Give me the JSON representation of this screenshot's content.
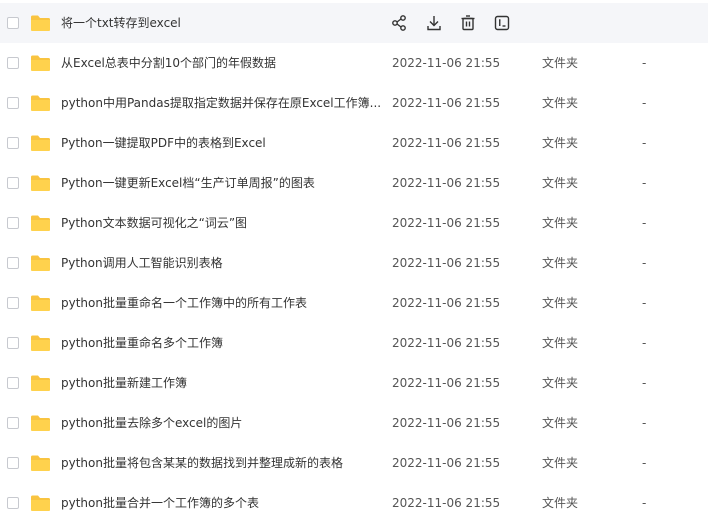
{
  "columns": {
    "type_label": "文件夹",
    "size_placeholder": "-"
  },
  "hover_actions": [
    {
      "name": "share-icon",
      "label": "share"
    },
    {
      "name": "download-icon",
      "label": "download"
    },
    {
      "name": "delete-icon",
      "label": "delete"
    },
    {
      "name": "more-info-icon",
      "label": "info"
    }
  ],
  "files": [
    {
      "name": "将一个txt转存到excel",
      "date": "",
      "type": "",
      "size": "",
      "hovered": true
    },
    {
      "name": "从Excel总表中分割10个部门的年假数据",
      "date": "2022-11-06 21:55",
      "type": "文件夹",
      "size": "-"
    },
    {
      "name": "python中用Pandas提取指定数据并保存在原Excel工作簿...",
      "date": "2022-11-06 21:55",
      "type": "文件夹",
      "size": "-"
    },
    {
      "name": "Python一键提取PDF中的表格到Excel",
      "date": "2022-11-06 21:55",
      "type": "文件夹",
      "size": "-"
    },
    {
      "name": "Python一键更新Excel档“生产订单周报”的图表",
      "date": "2022-11-06 21:55",
      "type": "文件夹",
      "size": "-"
    },
    {
      "name": "Python文本数据可视化之“词云”图",
      "date": "2022-11-06 21:55",
      "type": "文件夹",
      "size": "-"
    },
    {
      "name": "Python调用人工智能识别表格",
      "date": "2022-11-06 21:55",
      "type": "文件夹",
      "size": "-"
    },
    {
      "name": "python批量重命名一个工作簿中的所有工作表",
      "date": "2022-11-06 21:55",
      "type": "文件夹",
      "size": "-"
    },
    {
      "name": "python批量重命名多个工作簿",
      "date": "2022-11-06 21:55",
      "type": "文件夹",
      "size": "-"
    },
    {
      "name": "python批量新建工作簿",
      "date": "2022-11-06 21:55",
      "type": "文件夹",
      "size": "-"
    },
    {
      "name": "python批量去除多个excel的图片",
      "date": "2022-11-06 21:55",
      "type": "文件夹",
      "size": "-"
    },
    {
      "name": "python批量将包含某某的数据找到并整理成新的表格",
      "date": "2022-11-06 21:55",
      "type": "文件夹",
      "size": "-"
    },
    {
      "name": "python批量合并一个工作簿的多个表",
      "date": "2022-11-06 21:55",
      "type": "文件夹",
      "size": "-"
    }
  ]
}
